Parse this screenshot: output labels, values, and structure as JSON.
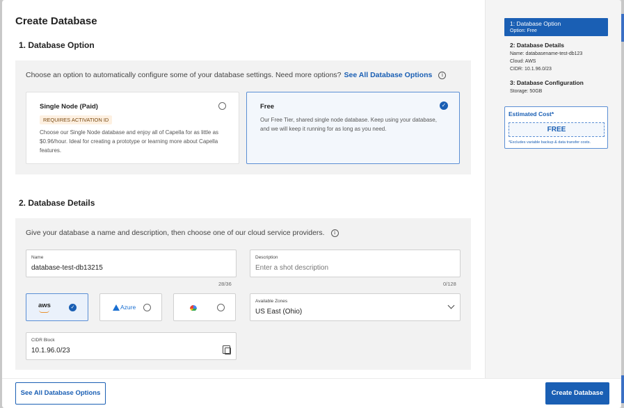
{
  "title": "Create Database",
  "section1": {
    "heading": "1. Database Option",
    "description": "Choose an option to automatically configure some of your database settings. Need more options?",
    "link": "See All Database Options",
    "cards": [
      {
        "title": "Single Node (Paid)",
        "badge": "REQUIRES ACTIVATION ID",
        "lines": [
          "Choose our Single Node database and enjoy all of Capella for as little as",
          "$0.96/hour. Ideal for creating a prototype or learning more about Capella",
          "features."
        ],
        "selected": false
      },
      {
        "title": "Free",
        "lines": [
          "Our Free Tier, shared single node database. Keep using your database,",
          "and we will keep it running for as long as you need."
        ],
        "selected": true
      }
    ]
  },
  "section2": {
    "heading": "2. Database Details",
    "description": "Give your database a name and description, then choose one of our cloud service providers.",
    "name": {
      "label": "Name",
      "value": "database-test-db13215",
      "counter": "28/36"
    },
    "description_field": {
      "label": "Description",
      "placeholder": "Enter a shot description",
      "counter": "0/128"
    },
    "providers": [
      {
        "id": "aws",
        "label": "aws",
        "selected": true
      },
      {
        "id": "azure",
        "label": "Azure",
        "selected": false
      },
      {
        "id": "gcp",
        "label": "",
        "selected": false
      }
    ],
    "zones": {
      "label": "Available Zones",
      "value": "US East (Ohio)"
    },
    "cidr": {
      "label": "CIDR Block",
      "value": "10.1.96.0/23"
    }
  },
  "sidebar": {
    "step1": {
      "title": "1: Database Option",
      "sub": "Option: Free"
    },
    "step2": {
      "title": "2: Database Details",
      "lines": [
        "Name: databasename-test-db123",
        "Cloud: AWS",
        "CIDR: 10.1.96.0/23"
      ]
    },
    "step3": {
      "title": "3: Database Configuration",
      "sub": "Storage: 50GB"
    },
    "cost": {
      "title": "Estimated Cost*",
      "value": "FREE",
      "note": "*Excludes variable backup & data transfer costs."
    }
  },
  "footer": {
    "secondary": "See All Database Options",
    "primary": "Create Database"
  },
  "colors": {
    "accent": "#1a5fb4",
    "badge_bg": "#fdf0e1",
    "panel_bg": "#f2f2f2"
  }
}
